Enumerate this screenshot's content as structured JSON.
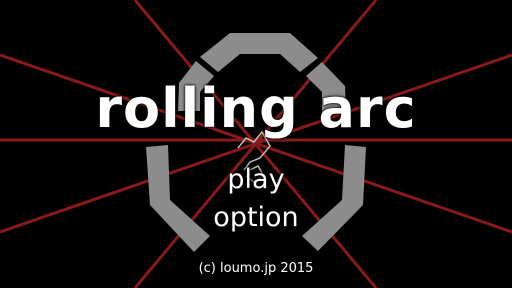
{
  "game": {
    "title": "rolling arc",
    "menu": {
      "play_label": "play",
      "option_label": "option"
    },
    "copyright": "(c) loumo.jp 2015"
  },
  "colors": {
    "background": "#000000",
    "ray": "#8a1a1a",
    "arc": "#8c8c8c",
    "text": "#ffffff"
  }
}
